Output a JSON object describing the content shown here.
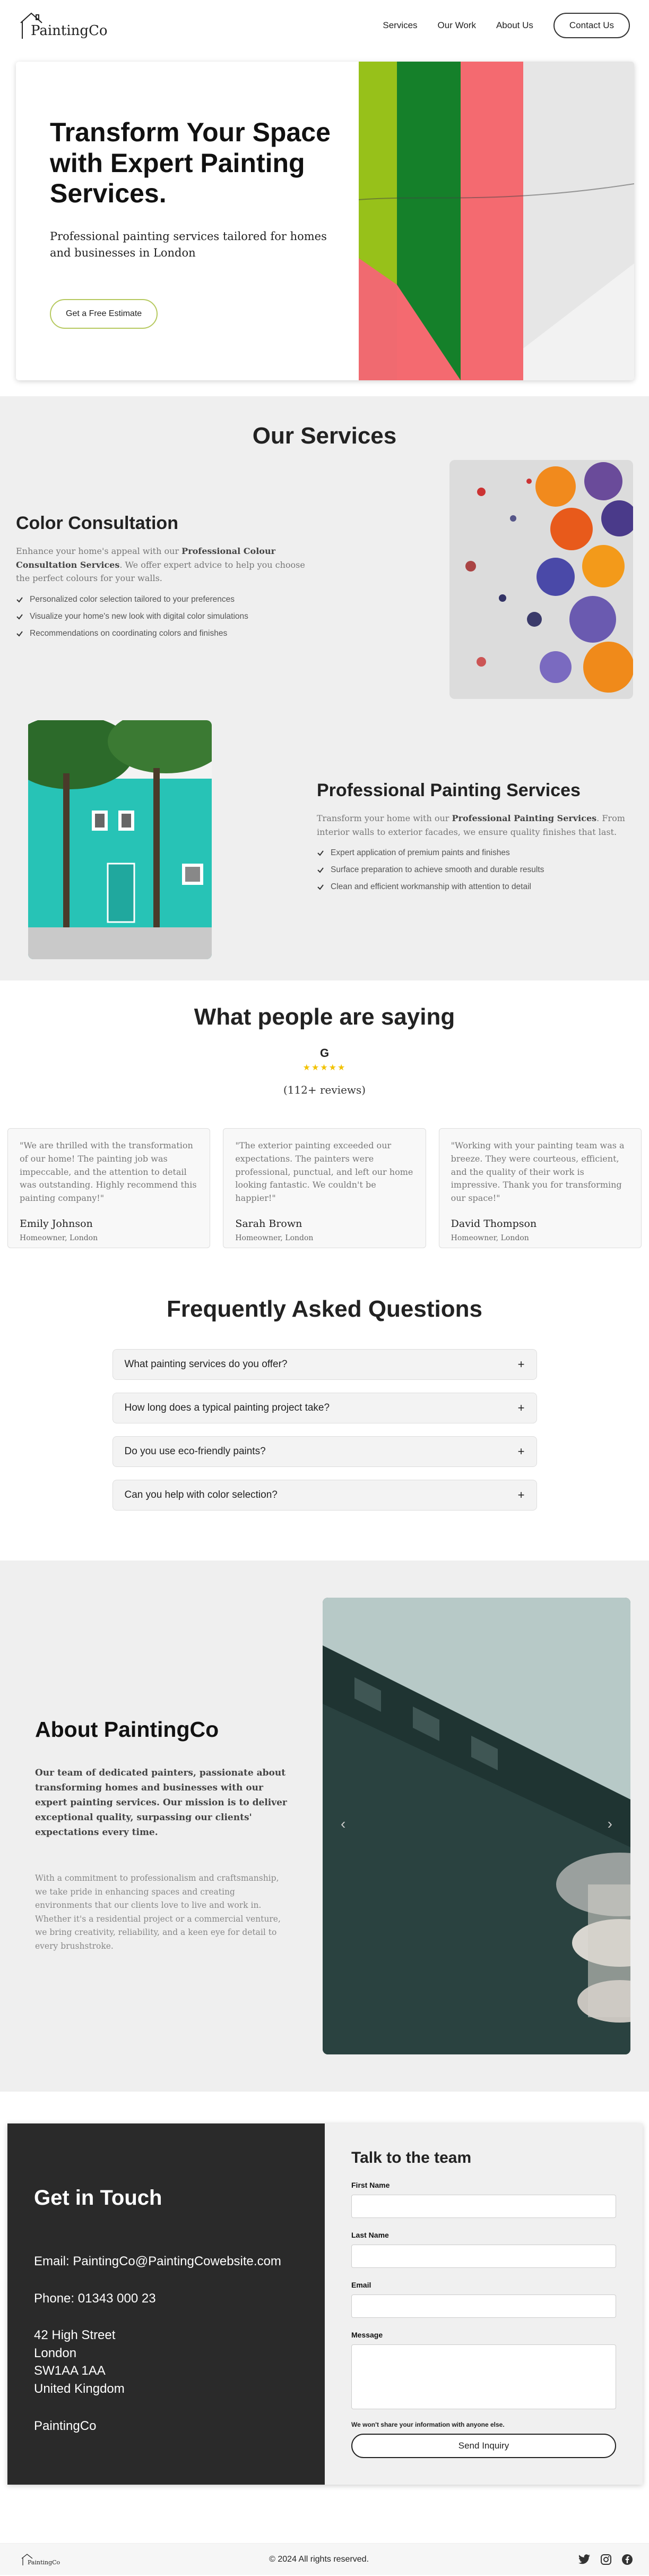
{
  "nav": {
    "logo_text": "PaintingCo",
    "links": [
      "Services",
      "Our Work",
      "About Us"
    ],
    "contact_label": "Contact Us"
  },
  "hero": {
    "title": "Transform Your Space with Expert Painting Services.",
    "subtitle": "Professional painting services tailored for homes and businesses in London",
    "cta_label": "Get a Free Estimate"
  },
  "services": {
    "title": "Our Services",
    "items": [
      {
        "title": "Color Consultation",
        "desc_pre": "Enhance your home's appeal with our ",
        "desc_bold": "Professional Colour Consultation Services",
        "desc_post": ". We offer expert advice to help you choose the perfect colours for your walls.",
        "bullets": [
          "Personalized color selection tailored to your preferences",
          "Visualize your home's new look with digital color simulations",
          "Recommendations on coordinating colors and finishes"
        ]
      },
      {
        "title": "Professional Painting Services",
        "desc_pre": "Transform your home with our ",
        "desc_bold": "Professional Painting Services",
        "desc_post": ". From interior walls to exterior facades, we ensure quality finishes that last.",
        "bullets": [
          "Expert application of premium paints and finishes",
          "Surface preparation to achieve smooth and durable results",
          "Clean and efficient workmanship with attention to detail"
        ]
      }
    ]
  },
  "testimonials": {
    "title": "What people are saying",
    "g_letter": "G",
    "stars": "★★★★★",
    "reviews": "(112+ reviews)",
    "cards": [
      {
        "quote": "\"We are thrilled with the transformation of our home! The painting job was impeccable, and the attention to detail was outstanding. Highly recommend this painting company!\"",
        "name": "Emily Johnson",
        "role": "Homeowner, London"
      },
      {
        "quote": "\"The exterior painting exceeded our expectations. The painters were professional, punctual, and left our home looking fantastic. We couldn't be happier!\"",
        "name": "Sarah Brown",
        "role": "Homeowner, London"
      },
      {
        "quote": "\"Working with your painting team was a breeze. They were courteous, efficient, and the quality of their work is impressive. Thank you for transforming our space!\"",
        "name": "David Thompson",
        "role": "Homeowner, London"
      }
    ]
  },
  "faq": {
    "title": "Frequently Asked Questions",
    "items": [
      "What painting services do you offer?",
      "How long does a typical painting project take?",
      "Do you use eco-friendly paints?",
      "Can you help with color selection?"
    ],
    "toggle": "+"
  },
  "about": {
    "title": "About PaintingCo",
    "lead": "Our team of dedicated painters, passionate about transforming homes and businesses with our expert painting services. Our mission is to deliver exceptional quality, surpassing our clients' expectations every time.",
    "body": "With a commitment to professionalism and craftsmanship, we take pride in enhancing spaces and creating environments that our clients love to live and work in. Whether it's a residential project or a commercial venture, we bring creativity, reliability, and a keen eye for detail to every brushstroke.",
    "prev": "‹",
    "next": "›"
  },
  "contact": {
    "title": "Get in Touch",
    "email": "Email: PaintingCo@PaintingCowebsite.com",
    "phone": "Phone: 01343 000 23",
    "address": [
      "42 High Street",
      "London",
      "SW1AA 1AA",
      "United Kingdom"
    ],
    "company": "PaintingCo",
    "form_title": "Talk to the team",
    "first_name": "First Name",
    "last_name": "Last Name",
    "email_label": "Email",
    "message_label": "Message",
    "note": "We won't share your information with anyone else.",
    "send_label": "Send Inquiry"
  },
  "footer": {
    "logo_text": "PaintingCo",
    "copyright": "© 2024 All rights reserved."
  }
}
